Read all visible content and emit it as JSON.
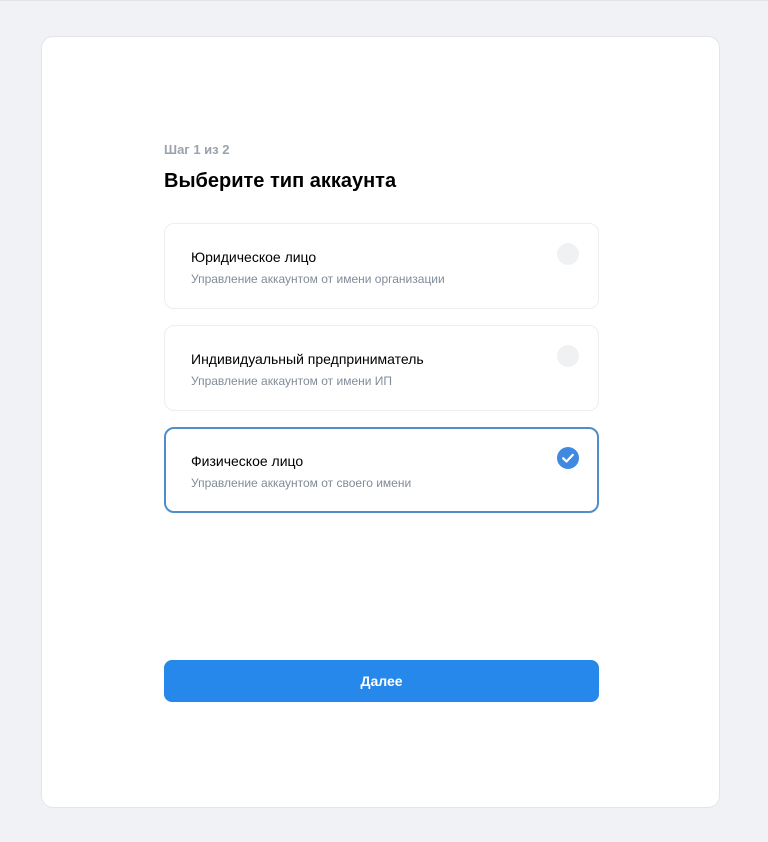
{
  "wizard": {
    "step_label": "Шаг 1 из 2",
    "title": "Выберите тип аккаунта"
  },
  "options": [
    {
      "title": "Юридическое лицо",
      "description": "Управление аккаунтом от имени организации",
      "selected": false
    },
    {
      "title": "Индивидуальный предприниматель",
      "description": "Управление аккаунтом от имени ИП",
      "selected": false
    },
    {
      "title": "Физическое лицо",
      "description": "Управление аккаунтом от своего имени",
      "selected": true
    }
  ],
  "actions": {
    "next_label": "Далее"
  },
  "colors": {
    "accent": "#2688eb",
    "selected_border": "#4f8fc9",
    "check_fill": "#3f8ae0",
    "page_background": "#f0f2f5"
  },
  "icons": {
    "selected": "check-circle-icon",
    "unselected": "radio-empty-icon"
  }
}
